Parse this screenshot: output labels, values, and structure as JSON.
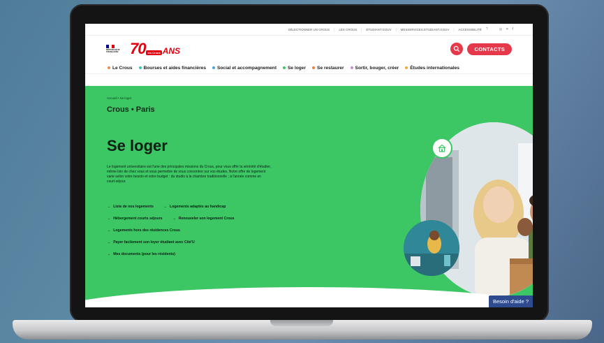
{
  "util_bar": {
    "items": [
      "SÉLECTIONNER UN CROUS",
      "LES CROUS",
      "ÉTUDIANT.GOUV",
      "MESSERVICES.ETUDIANT.GOUV",
      "ACCESSIBILITÉ"
    ]
  },
  "header": {
    "marianne_text": "RÉPUBLIQUE FRANÇAISE",
    "anniversary_number": "70",
    "anniversary_badge": "les Crous",
    "anniversary_suffix": "ANS",
    "contacts_label": "CONTACTS"
  },
  "nav": {
    "items": [
      {
        "label": "Le Crous",
        "color": "#f08a4b"
      },
      {
        "label": "Bourses et aides financières",
        "color": "#3cc6b4"
      },
      {
        "label": "Social et accompagnement",
        "color": "#4aa3df"
      },
      {
        "label": "Se loger",
        "color": "#3cc664"
      },
      {
        "label": "Se restaurer",
        "color": "#f07f3c"
      },
      {
        "label": "Sortir, bouger, créer",
        "color": "#c58ad7"
      },
      {
        "label": "Études internationales",
        "color": "#f0a63c"
      }
    ]
  },
  "hero": {
    "breadcrumb": "Accueil • Se loger",
    "site_name": "Crous • Paris",
    "title": "Se loger",
    "intro": "Le logement universitaire est l'une des principales missions du Crous, pour vous offrir la sérénité d'étudier, même loin de chez vous et vous permettre de vous concentrer sur vos études. Notre offre de logement varie selon votre besoin et votre budget : du studio à la chambre traditionnelle ; à l'année comme en court-séjour.",
    "links": [
      [
        "Liste de nos logements",
        "Logements adaptés au handicap"
      ],
      [
        "Hébergement courts séjours",
        "Renouveler son logement Crous"
      ],
      [
        "Logements hors des résidences Crous"
      ],
      [
        "Payer facilement son loyer étudiant avec Cité'U"
      ],
      [
        "Mes documents (pour les résidents)"
      ]
    ],
    "accent_color": "#3cc664"
  },
  "help_button": "Besoin d'aide ?"
}
